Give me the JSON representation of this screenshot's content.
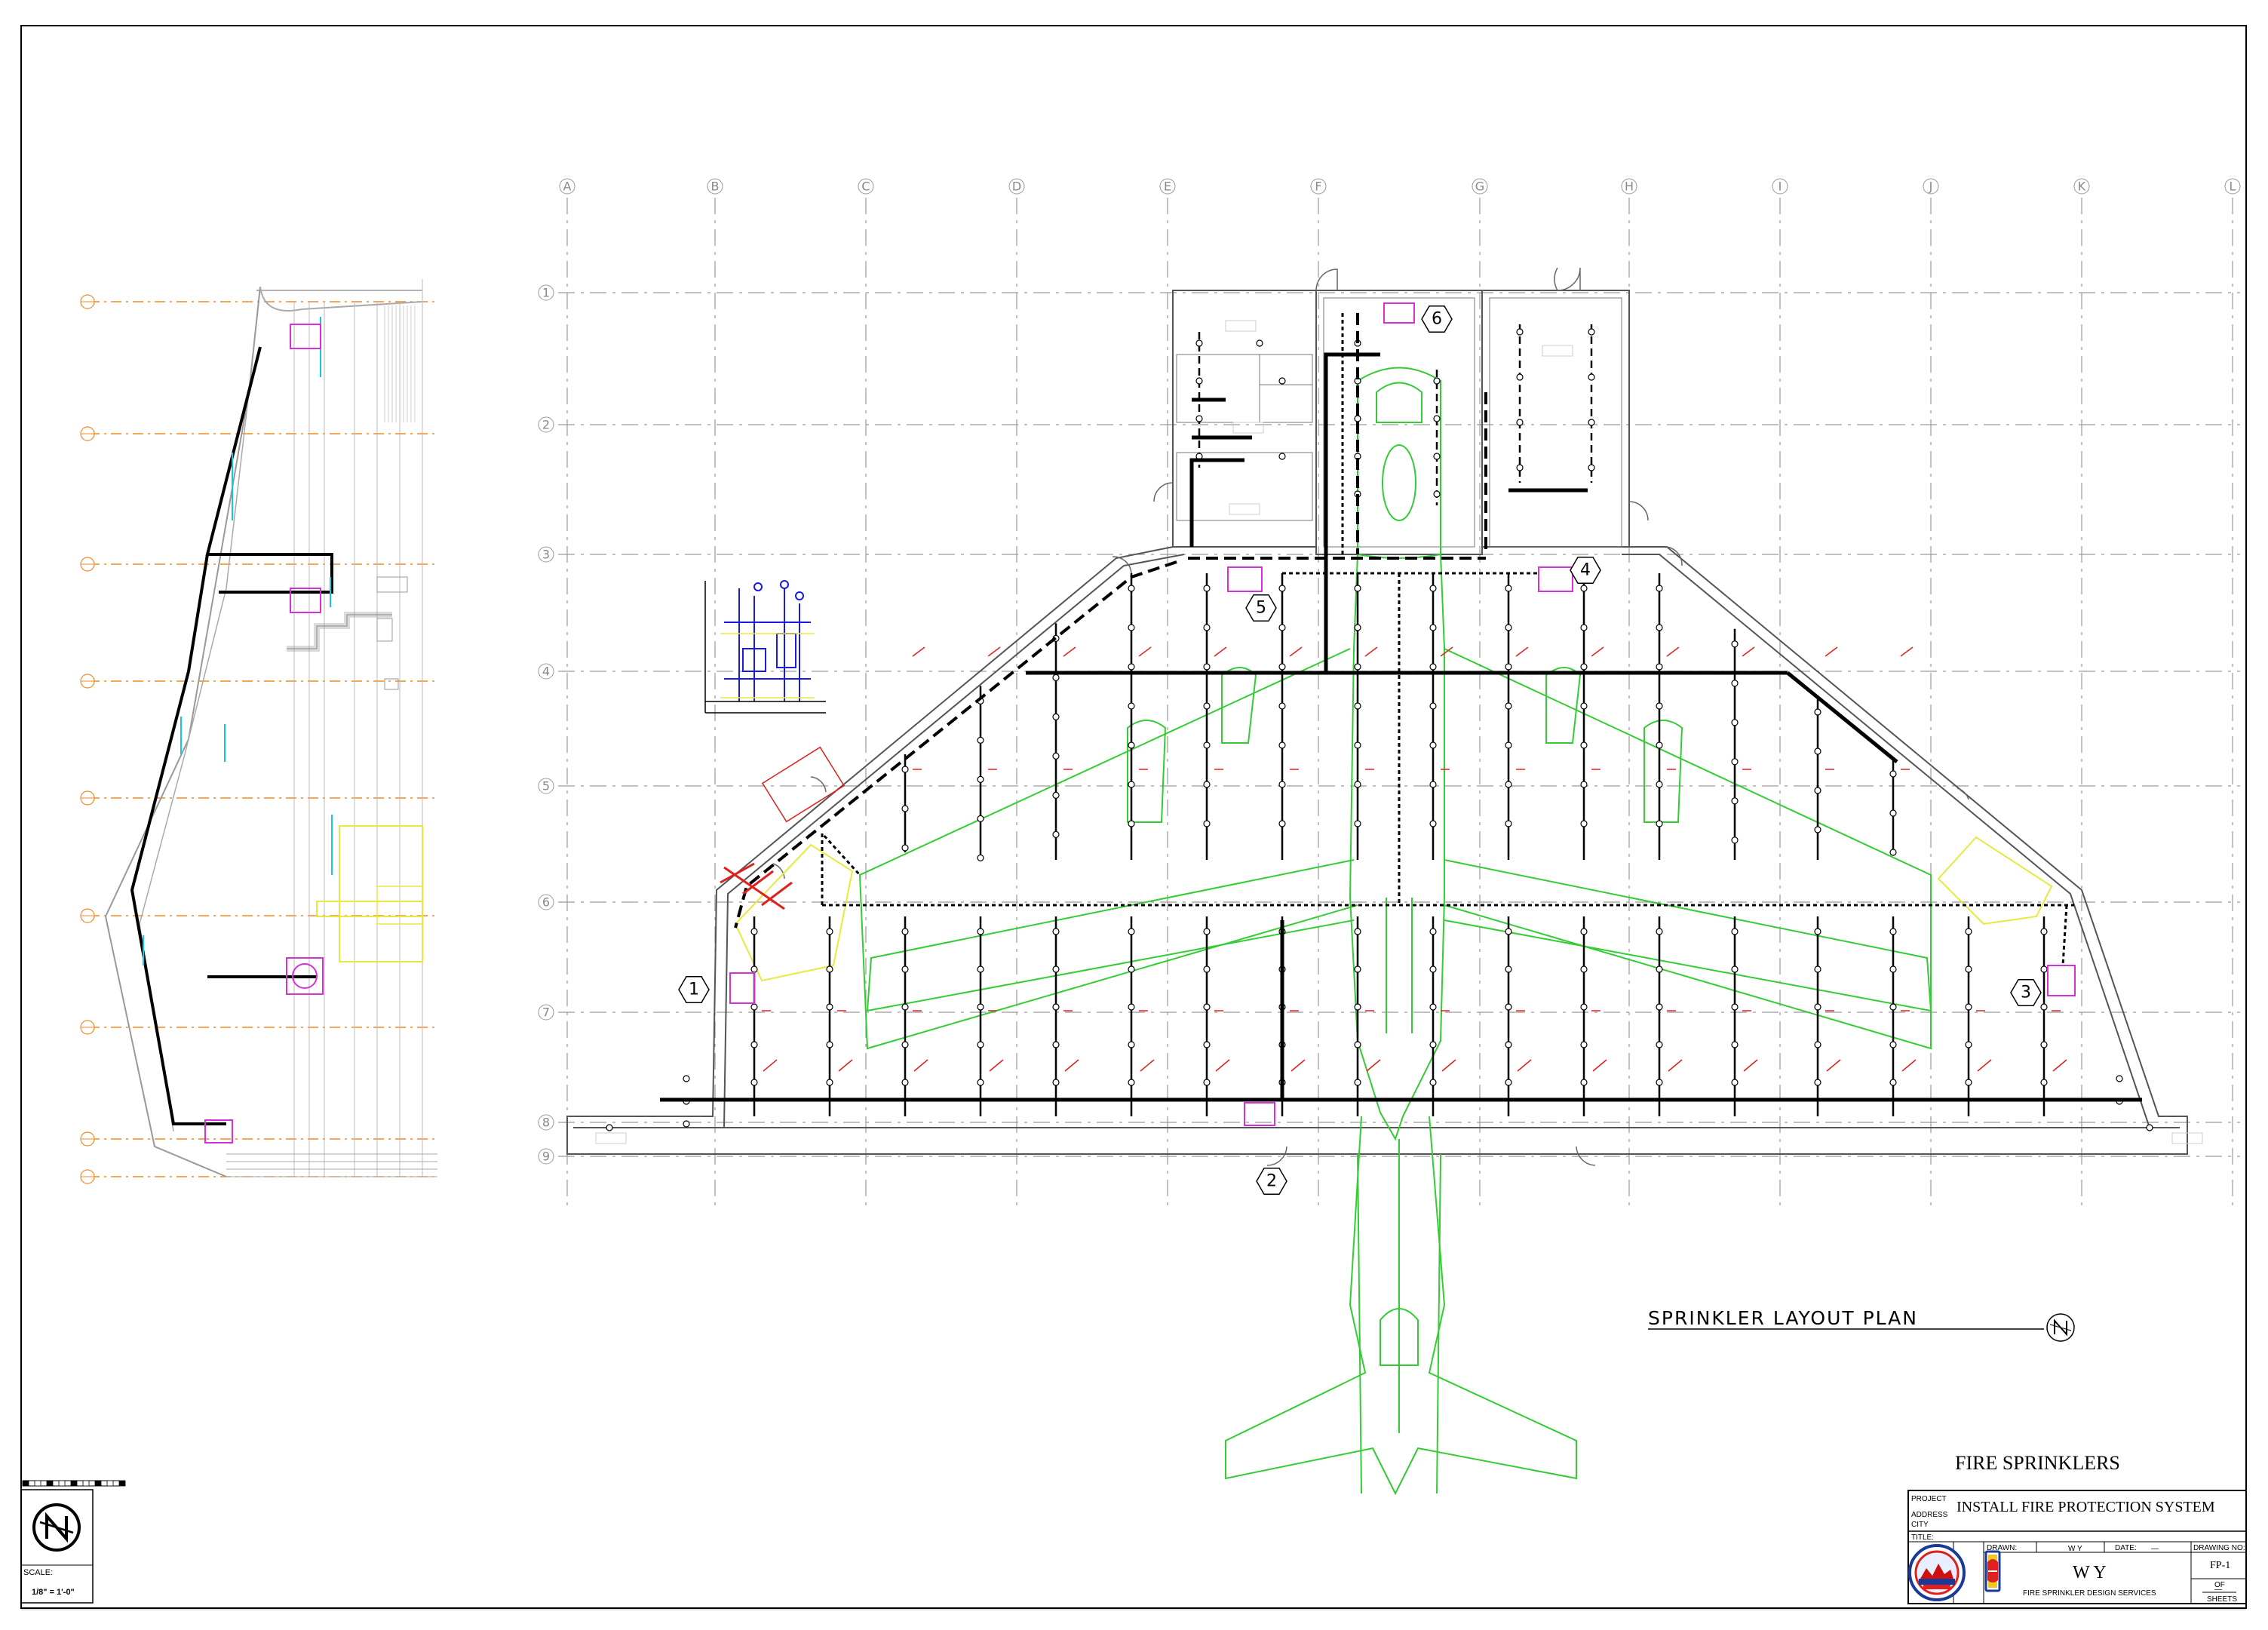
{
  "drawing": {
    "plan_title": "SPRINKLER LAYOUT PLAN",
    "grid_columns": [
      "A",
      "B",
      "C",
      "D",
      "E",
      "F",
      "G",
      "H",
      "I",
      "J",
      "K",
      "L"
    ],
    "grid_rows": [
      "1",
      "2",
      "3",
      "4",
      "5",
      "6",
      "7",
      "8",
      "9"
    ],
    "zone_markers": [
      "1",
      "2",
      "3",
      "4",
      "5",
      "6"
    ],
    "colors": {
      "pipe_main": "#000000",
      "sprinkler_red": "#e0201c",
      "aircraft_green": "#33cc33",
      "riser_magenta": "#d630d6",
      "riser_detail_blue": "#1a1ae6",
      "gridline_gray": "#9a9a9a",
      "elevation_orange": "#f08a24",
      "annotation_cyan": "#11c7e8",
      "zone_yellow": "#e8e840"
    },
    "icons": [
      "north-arrow-icon",
      "sprinkler-head-icon",
      "riser-icon",
      "company-logo-icon",
      "sprinkler-logo-icon"
    ]
  },
  "sheet_title": "FIRE SPRINKLERS",
  "title_block": {
    "project_label": "PROJECT",
    "address_label": "ADDRESS",
    "city_label": "CITY",
    "title_label": "TITLE:",
    "project_name": "INSTALL FIRE PROTECTION SYSTEM",
    "drawn_label": "DRAWN:",
    "drawn_value": "W Y",
    "date_label": "DATE:",
    "date_value": "—",
    "drawing_no_label": "DRAWING NO:",
    "drawing_no": "FP-1",
    "of_label": "OF",
    "sheets_value": "—",
    "sheets_label": "SHEETS",
    "company_name": "W Y",
    "company_subtitle": "FIRE SPRINKLER DESIGN SERVICES"
  },
  "scale_block": {
    "scale_label": "SCALE:",
    "scale_value": "1/8\" = 1'-0\""
  }
}
